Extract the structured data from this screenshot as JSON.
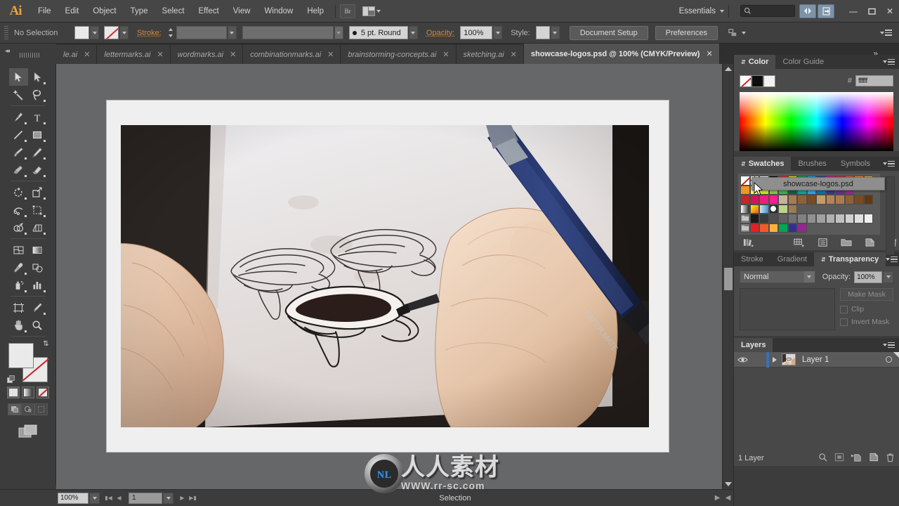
{
  "app": {
    "name": "Adobe Illustrator",
    "logo_text": "Ai",
    "workspace": "Essentials"
  },
  "menubar": {
    "items": [
      "File",
      "Edit",
      "Object",
      "Type",
      "Select",
      "Effect",
      "View",
      "Window",
      "Help"
    ],
    "bridge_label": "Br",
    "arrange_icon": "arrange-documents-icon",
    "search_placeholder": "",
    "window_controls": {
      "minimize": "—",
      "maximize": "❐",
      "close": "✕"
    }
  },
  "control_bar": {
    "selection_status": "No Selection",
    "fill_label": "",
    "stroke_label": "Stroke:",
    "stroke_weight": "",
    "stroke_profile": "",
    "brush_definition": "5 pt. Round",
    "opacity_label": "Opacity:",
    "opacity_value": "100%",
    "style_label": "Style:",
    "document_setup_label": "Document Setup",
    "preferences_label": "Preferences"
  },
  "tabs": [
    {
      "label": "le.ai",
      "active": false
    },
    {
      "label": "lettermarks.ai",
      "active": false
    },
    {
      "label": "wordmarks.ai",
      "active": false
    },
    {
      "label": "combinationmarks.ai",
      "active": false
    },
    {
      "label": "brainstorming-concepts.ai",
      "active": false
    },
    {
      "label": "sketching.ai",
      "active": false
    },
    {
      "label": "showcase-logos.psd @ 100% (CMYK/Preview)",
      "active": true
    }
  ],
  "tabs_overflow": "»",
  "toolbar": {
    "tools": [
      "selection-tool",
      "direct-selection-tool",
      "magic-wand-tool",
      "lasso-tool",
      "pen-tool",
      "type-tool",
      "line-segment-tool",
      "rectangle-tool",
      "paintbrush-tool",
      "pencil-tool",
      "blob-brush-tool",
      "eraser-tool",
      "rotate-tool",
      "scale-tool",
      "width-tool",
      "free-transform-tool",
      "shape-builder-tool",
      "perspective-grid-tool",
      "mesh-tool",
      "gradient-tool",
      "eyedropper-tool",
      "blend-tool",
      "symbol-sprayer-tool",
      "column-graph-tool",
      "artboard-tool",
      "slice-tool",
      "hand-tool",
      "zoom-tool"
    ],
    "fill_color": "#eaeaea",
    "stroke_color": "#eaeaea",
    "color_modes": [
      "color-mode",
      "gradient-mode",
      "none-mode"
    ],
    "draw_modes": [
      "draw-normal",
      "draw-behind",
      "draw-inside"
    ],
    "screen_mode": "change-screen-mode"
  },
  "canvas": {
    "document_name": "showcase-logos.psd",
    "artboard_description": "Photograph of a hand sketching brain-shaped logo concepts on white paper with a blue mechanical pencil",
    "pencil_brand": "PAPER MATE"
  },
  "status_bar": {
    "zoom_level": "100%",
    "page_number": "1",
    "status_text": "Selection",
    "first_page_icon": "first-page-icon",
    "prev_page_icon": "prev-page-icon",
    "next_page_icon": "next-page-icon",
    "last_page_icon": "last-page-icon"
  },
  "tooltip": {
    "text": "showcase-logos.psd"
  },
  "panels": {
    "color": {
      "tabs": [
        {
          "label": "Color",
          "active": true
        },
        {
          "label": "Color Guide",
          "active": false
        }
      ],
      "hex_label": "#",
      "hex_value": "ffffff",
      "chips": [
        "none",
        "#000000",
        "#ffffff"
      ]
    },
    "swatches": {
      "tabs": [
        {
          "label": "Swatches",
          "active": true
        },
        {
          "label": "Brushes",
          "active": false
        },
        {
          "label": "Symbols",
          "active": false
        }
      ],
      "rows": [
        [
          "none",
          "registration",
          "white",
          "#000000",
          "#ed1c24",
          "#fff200",
          "#00a651",
          "#00aeef",
          "#2e3192",
          "#ec008c",
          "#ed1c24",
          "#f15a29",
          "#f7941e",
          "#fbb040"
        ],
        [
          "#f7941e",
          "#fff568",
          "#d7df23",
          "#8dc63f",
          "#39b54a",
          "#006838",
          "#00a99d",
          "#27aae1",
          "#0071bc",
          "#2b3990",
          "#662d91",
          "#92278f"
        ],
        [
          "#c1272d",
          "#d4145a",
          "#ed1e79",
          "#ff1d8e",
          "#c7b299",
          "#a67c52",
          "#8c6239",
          "#754c24",
          "#c69c6d",
          "#b5835a",
          "#a97c50",
          "#8a6138",
          "#754c24",
          "#603913"
        ],
        [
          "gradient-white-black",
          "gradient-yellow-orange",
          "gradient-blue-white",
          "pattern-circle",
          "pattern-leaf",
          "pattern-texture"
        ],
        [
          "folder",
          "#1a1a1a",
          "#3a3a3a",
          "#4f4f4f",
          "#5f5f5f",
          "#707070",
          "#808080",
          "#909090",
          "#a0a0a0",
          "#b0b0b0",
          "#c0c0c0",
          "#d0d0d0",
          "#e0e0e0",
          "#f0f0f0"
        ],
        [
          "folder",
          "#ed1c24",
          "#f15a29",
          "#fbb040",
          "#fff200",
          "#00a651",
          "#2e3192",
          "#92278f"
        ]
      ],
      "footer_icons": [
        "swatch-libraries-icon",
        "show-swatch-kinds-icon",
        "swatch-options-icon",
        "new-color-group-icon",
        "new-swatch-icon",
        "delete-swatch-icon"
      ]
    },
    "transparency": {
      "tabs": [
        {
          "label": "Stroke",
          "active": false
        },
        {
          "label": "Gradient",
          "active": false
        },
        {
          "label": "Transparency",
          "active": true
        }
      ],
      "blend_mode": "Normal",
      "opacity_label": "Opacity:",
      "opacity_value": "100%",
      "make_mask_label": "Make Mask",
      "clip_label": "Clip",
      "invert_mask_label": "Invert Mask"
    },
    "layers": {
      "tabs": [
        {
          "label": "Layers",
          "active": true
        }
      ],
      "rows": [
        {
          "name": "Layer 1",
          "visible": true,
          "locked": false,
          "selected": true
        }
      ],
      "footer_count": "1 Layer",
      "footer_icons": [
        "locate-object-icon",
        "make-clipping-mask-icon",
        "create-new-sublayer-icon",
        "create-new-layer-icon",
        "delete-selection-icon"
      ]
    }
  },
  "watermark": {
    "chinese_text": "人人素材",
    "url": "WWW.rr-sc.com",
    "mark": "ɴʟ"
  }
}
